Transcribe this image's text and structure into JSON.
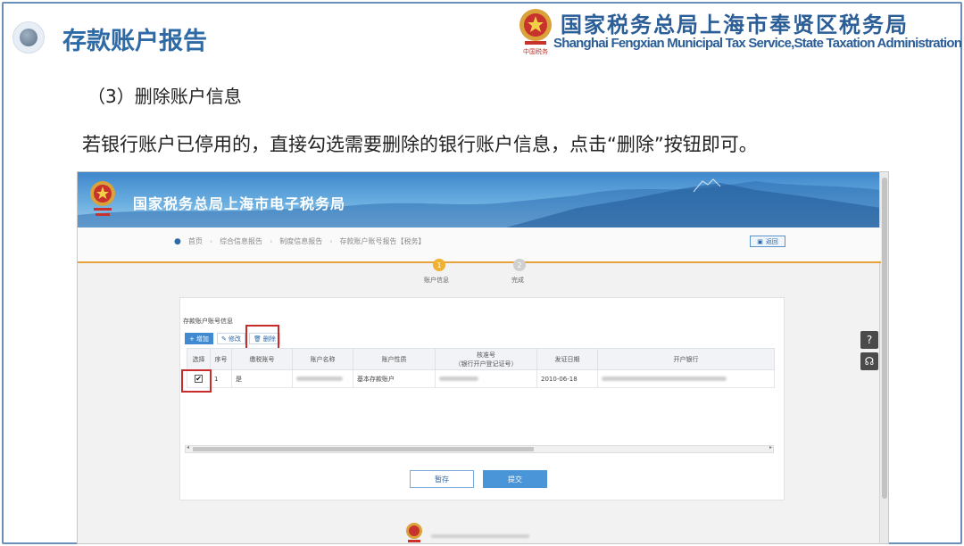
{
  "slide": {
    "title": "存款账户报告",
    "org_cn": "国家税务总局上海市奉贤区税务局",
    "org_en": "Shanghai Fengxian Municipal Tax Service,State Taxation  Administration",
    "step_heading": "（3）删除账户信息",
    "instruction": "若银行账户已停用的，直接勾选需要删除的银行账户信息，点击“删除”按钮即可。"
  },
  "app": {
    "banner_title": "国家税务总局上海市电子税务局",
    "breadcrumb": [
      "首页",
      "综合信息报告",
      "制度信息报告",
      "存款账户账号报告【税务】"
    ],
    "back_label": "返回",
    "steps": [
      {
        "num": "1",
        "label": "账户信息",
        "active": true
      },
      {
        "num": "2",
        "label": "完成",
        "active": false
      }
    ],
    "panel_title": "存款账户账号信息",
    "toolbar": {
      "add": "增加",
      "edit": "修改",
      "delete": "删除"
    },
    "table": {
      "headers": [
        "选择",
        "序号",
        "缴税账号",
        "账户名称",
        "账户性质",
        "核准号\n（银行开户登记证号）",
        "发证日期",
        "开户银行"
      ],
      "rows": [
        {
          "checked": true,
          "seq": "1",
          "tax_account": "是",
          "account_name": "",
          "account_type": "基本存款账户",
          "approval_no": "",
          "issue_date": "2010-06-18",
          "bank": ""
        }
      ]
    },
    "buttons": {
      "save": "暂存",
      "submit": "提交"
    },
    "colors": {
      "highlight": "#c92a2a",
      "primary": "#4a95d8",
      "step_active": "#f0b030"
    }
  }
}
